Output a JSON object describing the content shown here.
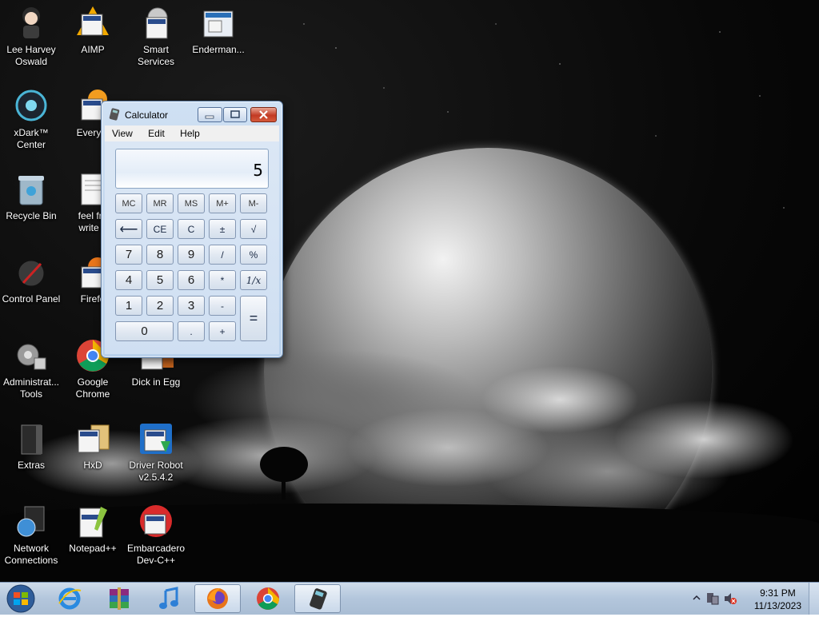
{
  "desktop_icons": [
    {
      "label": "Lee Harvey\nOswald",
      "icon": "character-icon"
    },
    {
      "label": "AIMP",
      "icon": "aimp-icon"
    },
    {
      "label": "Smart\nServices",
      "icon": "gear-services-icon"
    },
    {
      "label": "Enderman...",
      "icon": "window-app-icon"
    },
    {
      "label": "xDark™\nCenter",
      "icon": "xdark-orb-icon"
    },
    {
      "label": "Everyth",
      "icon": "everything-icon"
    },
    {
      "label": "Recycle Bin",
      "icon": "recycle-bin-icon"
    },
    {
      "label": "feel fre\nwrite a",
      "icon": "text-document-icon"
    },
    {
      "label": "Control Panel",
      "icon": "control-panel-icon"
    },
    {
      "label": "Firefo",
      "icon": "firefox-icon"
    },
    {
      "label": "Administrat...\nTools",
      "icon": "admin-tools-icon"
    },
    {
      "label": "Google\nChrome",
      "icon": "chrome-icon"
    },
    {
      "label": "Dick in Egg",
      "icon": "game-icon"
    },
    {
      "label": "Extras",
      "icon": "folder-icon"
    },
    {
      "label": "HxD",
      "icon": "hxd-icon"
    },
    {
      "label": "Driver Robot\nv2.5.4.2",
      "icon": "driver-robot-icon"
    },
    {
      "label": "Network\nConnections",
      "icon": "network-icon"
    },
    {
      "label": "Notepad++",
      "icon": "notepadpp-icon"
    },
    {
      "label": "Embarcadero\nDev-C++",
      "icon": "devcpp-icon"
    }
  ],
  "calculator": {
    "title": "Calculator",
    "menu": [
      "View",
      "Edit",
      "Help"
    ],
    "display_value": "5",
    "keys": [
      [
        "MC",
        "MR",
        "MS",
        "M+",
        "M-"
      ],
      [
        "⟵",
        "CE",
        "C",
        "±",
        "√"
      ],
      [
        "7",
        "8",
        "9",
        "/",
        "%"
      ],
      [
        "4",
        "5",
        "6",
        "*",
        "1/x"
      ],
      [
        "1",
        "2",
        "3",
        "-",
        "="
      ],
      [
        "0",
        ".",
        "+"
      ]
    ]
  },
  "taskbar": {
    "items": [
      "start-orb",
      "internet-explorer-icon",
      "winrar-icon",
      "itunes-icon",
      "firefox-icon",
      "chrome-icon",
      "calculator-icon"
    ],
    "clock_time": "9:31 PM",
    "clock_date": "11/13/2023"
  },
  "colors": {
    "taskbar": "#b3c6dc",
    "window_frame": "#b9d1ec",
    "close_button": "#c23a24"
  }
}
